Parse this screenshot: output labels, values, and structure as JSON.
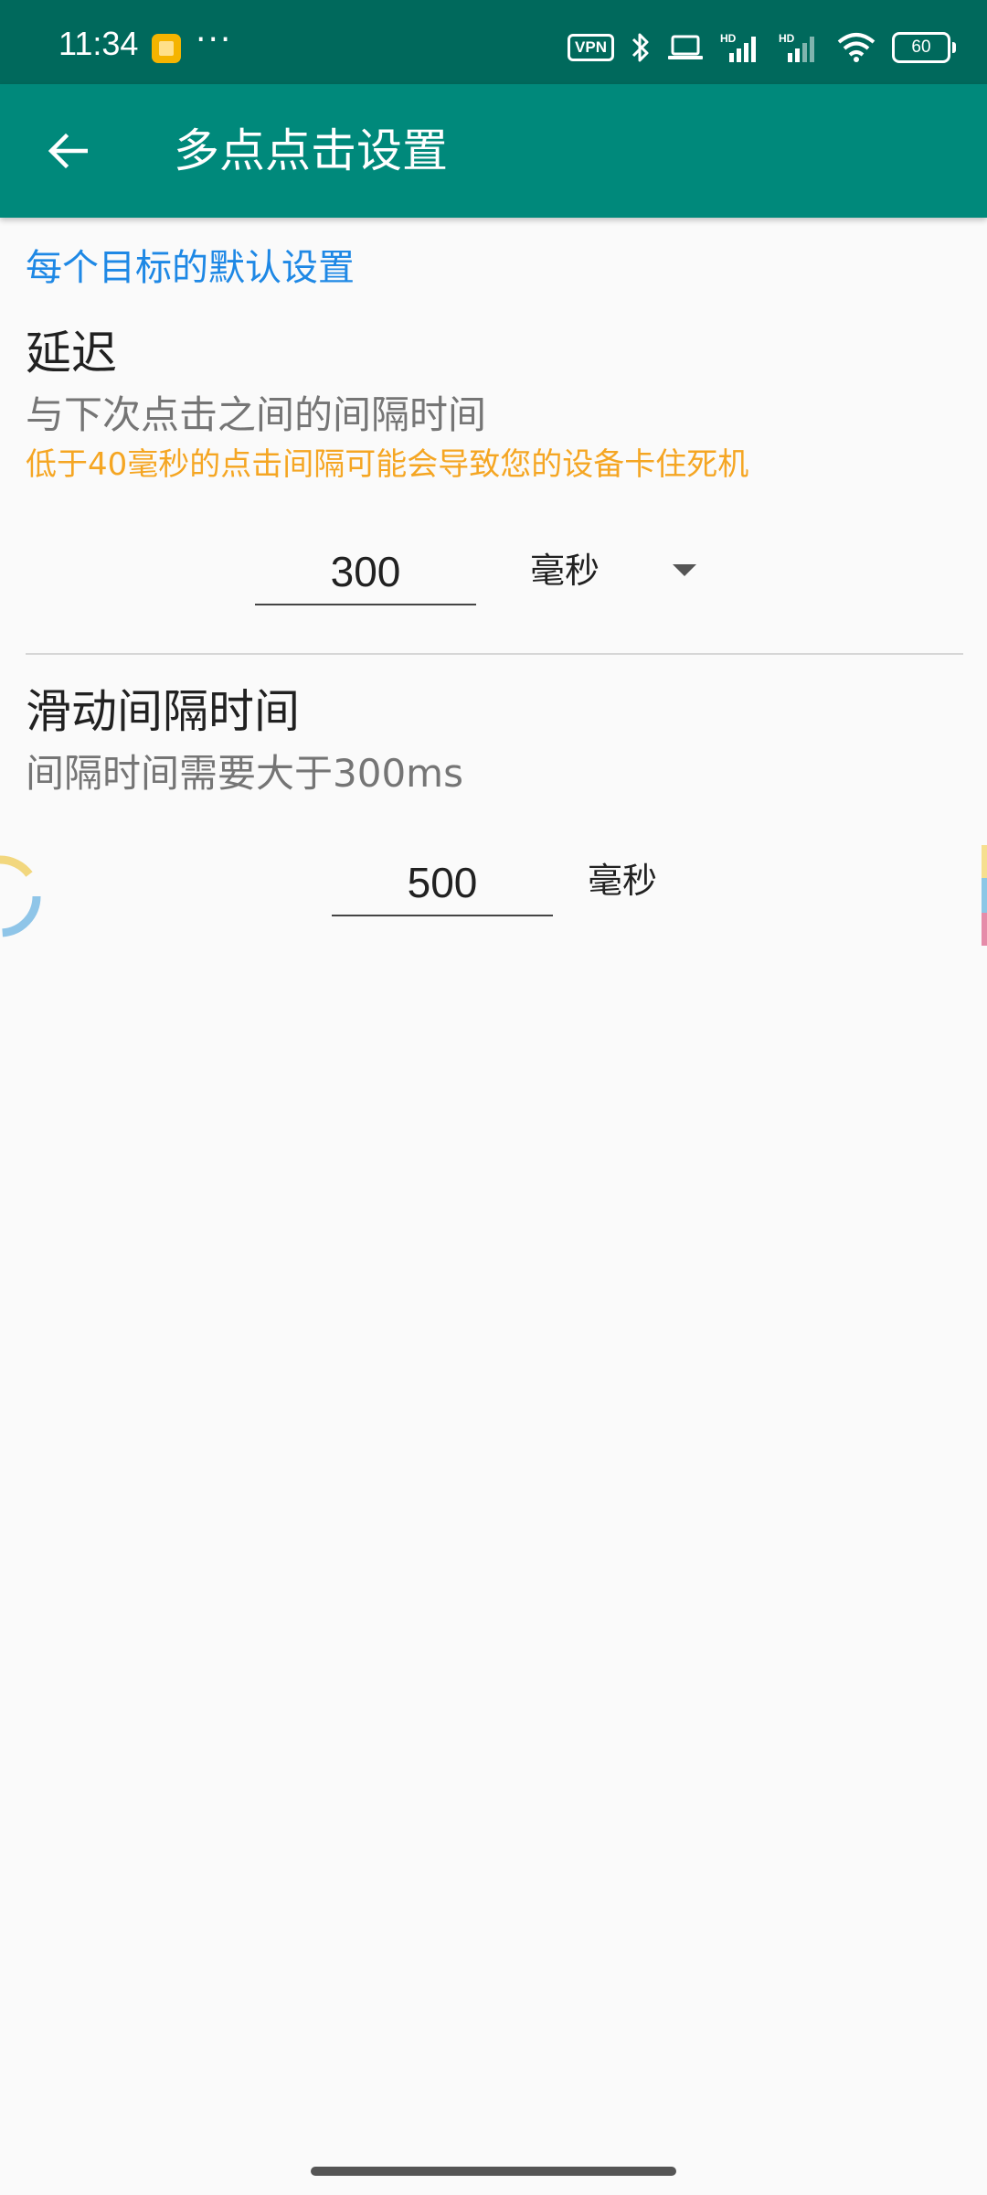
{
  "status_bar": {
    "time": "11:34",
    "more": "···",
    "vpn": "VPN",
    "battery": "60",
    "notification_icon": "orange-app-notification-icon",
    "icons": [
      "vpn-icon",
      "bluetooth-icon",
      "laptop-icon",
      "signal-hd-icon",
      "signal-hd-icon",
      "wifi-icon",
      "battery-icon"
    ]
  },
  "app_bar": {
    "title": "多点点击设置",
    "back_icon": "arrow-left-icon"
  },
  "section": {
    "header": "每个目标的默认设置"
  },
  "delay": {
    "title": "延迟",
    "summary": "与下次点击之间的间隔时间",
    "warning": "低于40毫秒的点击间隔可能会导致您的设备卡住死机",
    "value": "300",
    "unit": "毫秒"
  },
  "swipe": {
    "title": "滑动间隔时间",
    "summary": "间隔时间需要大于300ms",
    "value": "500",
    "unit": "毫秒"
  },
  "colors": {
    "status_bar": "#00695c",
    "app_bar": "#00897b",
    "section_header": "#1e88e5",
    "warning": "#f5a623",
    "background": "#fafafa"
  }
}
